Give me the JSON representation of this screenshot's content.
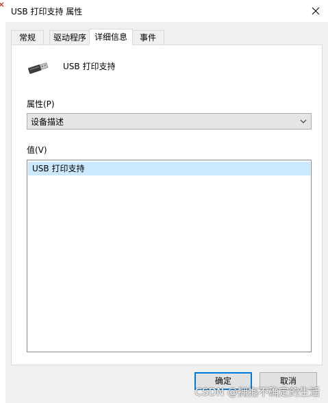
{
  "window": {
    "title": "USB 打印支持 属性",
    "close_symbol": "✕"
  },
  "tabs": [
    {
      "label": "常规",
      "active": false
    },
    {
      "label": "驱动程序",
      "active": false
    },
    {
      "label": "详细信息",
      "active": true
    },
    {
      "label": "事件",
      "active": false
    }
  ],
  "device": {
    "icon": "usb-plug-icon",
    "name": "USB 打印支持"
  },
  "property": {
    "label": "属性(P)",
    "selected": "设备描述"
  },
  "value": {
    "label": "值(V)",
    "items": [
      "USB 打印支持"
    ]
  },
  "buttons": {
    "ok": "确定",
    "cancel": "取消"
  },
  "watermark": "CSDN @拥抱不确定的生活",
  "colors": {
    "accent": "#0078d7",
    "selection": "#cce8ff"
  }
}
